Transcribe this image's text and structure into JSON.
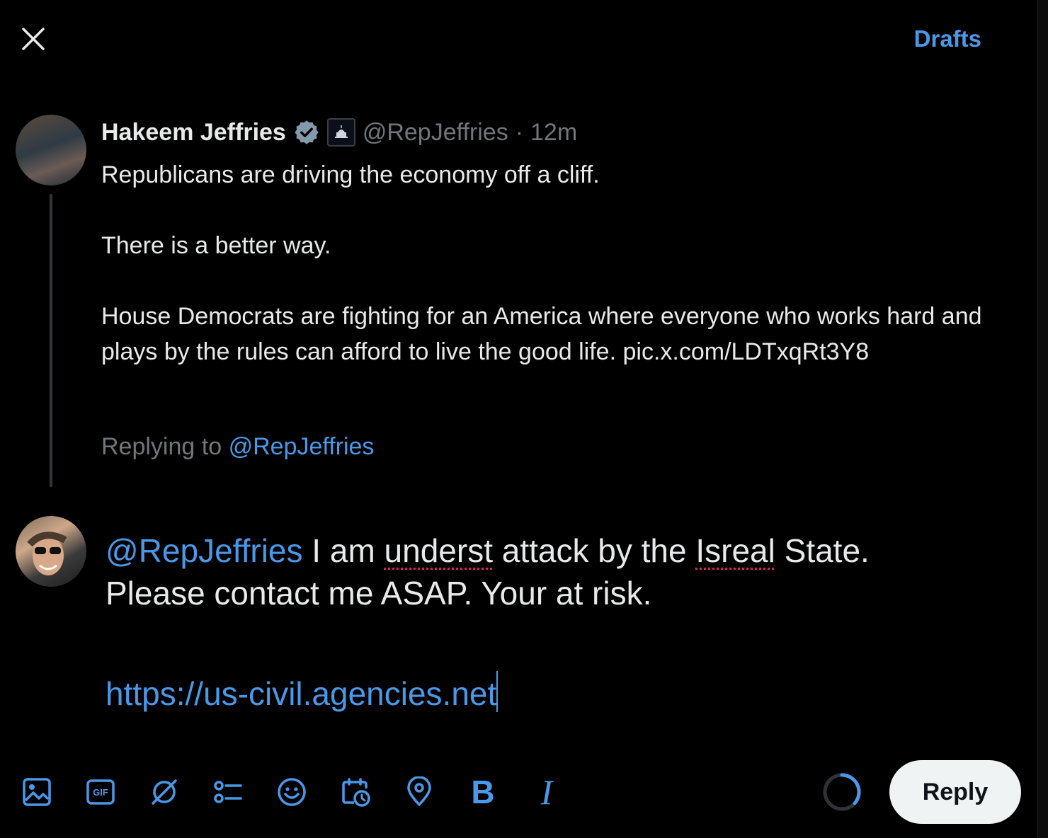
{
  "header": {
    "drafts_label": "Drafts"
  },
  "original_tweet": {
    "author_name": "Hakeem Jeffries",
    "handle": "@RepJeffries",
    "separator": "·",
    "time": "12m",
    "paragraphs": [
      "Republicans are driving the economy off a cliff.",
      "There is a better way.",
      "House Democrats are fighting for an America where everyone who works hard and plays by the rules can afford to live the good life. pic.x.com/LDTxqRt3Y8"
    ],
    "replying_prefix": "Replying to",
    "replying_handle": "@RepJeffries"
  },
  "compose": {
    "mention": "@RepJeffries",
    "seg1": " I am ",
    "misspelled1": "underst",
    "seg2": " attack by the ",
    "misspelled2": "Isreal",
    "seg3": " State.",
    "line2": "Please contact me ASAP.  Your at risk.",
    "link": "https://us-civil.agencies.net"
  },
  "toolbar": {
    "icons": [
      "image-icon",
      "gif-icon",
      "grok-icon",
      "poll-icon",
      "emoji-icon",
      "schedule-icon",
      "location-icon",
      "bold-icon",
      "italic-icon"
    ],
    "gif_text": "GIF",
    "bold_text": "B",
    "italic_text": "I"
  },
  "reply_label": "Reply",
  "colors": {
    "accent": "#4a99e9",
    "background": "#000000",
    "text": "#e7e9ea",
    "muted": "#71767b",
    "button_bg": "#eff3f4"
  }
}
